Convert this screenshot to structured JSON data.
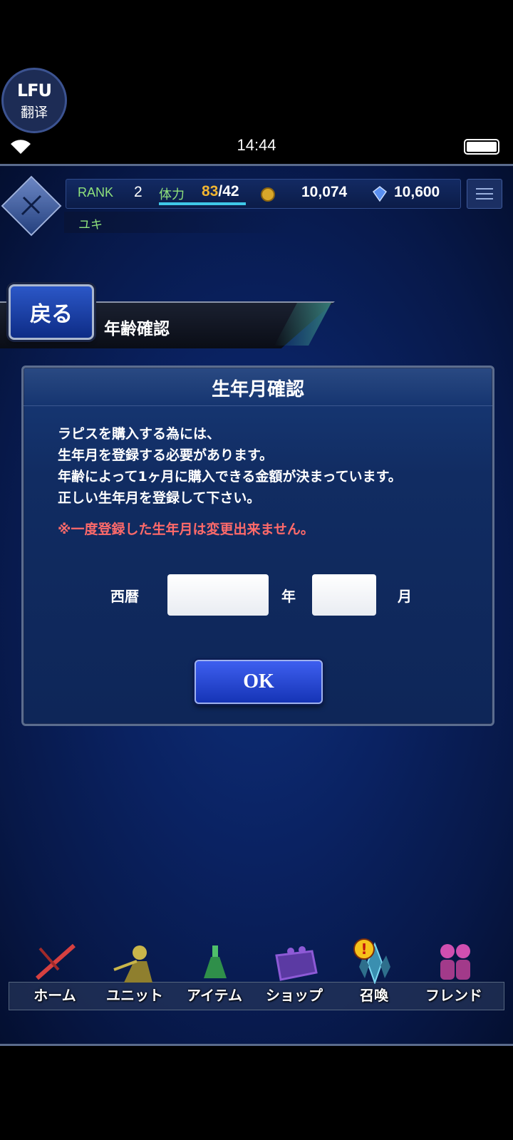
{
  "overlay": {
    "logo": "ᒪFU",
    "label": "翻译"
  },
  "status_bar": {
    "time": "14:44"
  },
  "header": {
    "rank_label": "RANK",
    "rank_value": "2",
    "stamina_label": "体力",
    "stamina_current": "83",
    "stamina_max": "/42",
    "stamina_fill": 1.0,
    "gil": "10,074",
    "lapis": "10,600",
    "player_name": "ユキ"
  },
  "page": {
    "back_label": "戻る",
    "title": "年齢確認"
  },
  "dialog": {
    "title": "生年月確認",
    "body_lines": [
      "ラピスを購入する為には、",
      "生年月を登録する必要があります。",
      "年齢によって1ヶ月に購入できる金額が決まっています。",
      "正しい生年月を登録して下さい。"
    ],
    "warning": "※一度登録した生年月は変更出来ません。",
    "era_label": "西暦",
    "year_value": "",
    "year_unit": "年",
    "month_value": "",
    "month_unit": "月",
    "ok_label": "OK"
  },
  "nav": {
    "items": [
      {
        "label": "ホーム",
        "icon": "sword-icon",
        "color": "#d64040"
      },
      {
        "label": "ユニット",
        "icon": "warrior-icon",
        "color": "#c9b54a"
      },
      {
        "label": "アイテム",
        "icon": "potion-icon",
        "color": "#4fc06a"
      },
      {
        "label": "ショップ",
        "icon": "shop-bag-icon",
        "color": "#8d5ad6"
      },
      {
        "label": "召喚",
        "icon": "crystal-icon",
        "color": "#4fb7d6",
        "alert": "!"
      },
      {
        "label": "フレンド",
        "icon": "friends-icon",
        "color": "#d04fb0"
      }
    ]
  },
  "colors": {
    "accent_green": "#8fe27c",
    "warning_red": "#ff6a6a",
    "stamina_gold": "#f1b531"
  }
}
